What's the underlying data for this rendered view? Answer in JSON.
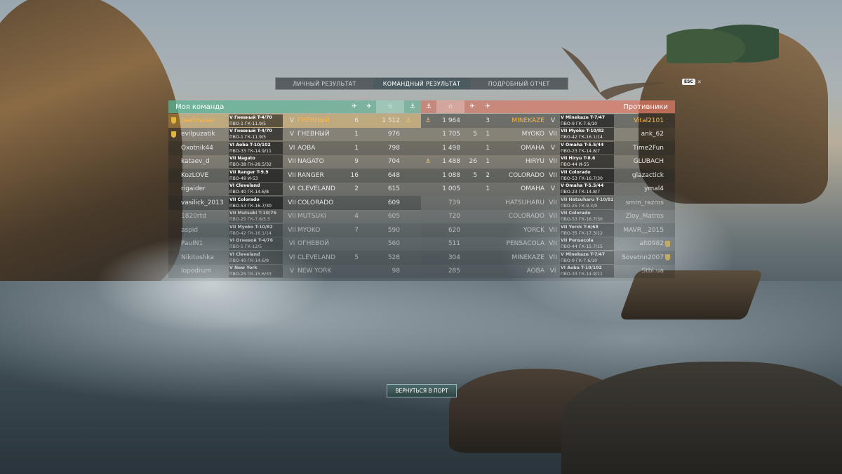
{
  "tabs": [
    "ЛИЧНЫЙ РЕЗУЛЬТАТ",
    "КОМАНДНЫЙ РЕЗУЛЬТАТ",
    "ПОДРОБНЫЙ ОТЧЕТ"
  ],
  "active_tab": 1,
  "esc_key": "ESC",
  "my_team_title": "Моя команда",
  "enemy_team_title": "Противники",
  "icons": {
    "plane": "✈",
    "fighter": "✈",
    "star": "☆",
    "anchor": "⚓",
    "close": "✕"
  },
  "return_button": "ВЕРНУТЬСЯ В ПОРТ",
  "my_team": [
    {
      "player": "beefmaker",
      "me": true,
      "medal": true,
      "card1": "V Гневный     T-4/70",
      "card2": "ПВО-1    ГК-11.9/5",
      "tier": "V",
      "ship": "ГНЕВНЫЙ",
      "frags": "6",
      "xp": "1 512",
      "anchor": true
    },
    {
      "player": "evilpuzatik",
      "medal": true,
      "card1": "V Гневный     T-4/70",
      "card2": "ПВО-1    ГК-11.9/5",
      "tier": "V",
      "ship": "ГНЕВНЫЙ",
      "frags": "1",
      "xp": "976"
    },
    {
      "player": "Oxotnik44",
      "card1": "VI Aoba    T-10/102",
      "card2": "ПВО-33   ГК-14.9/11",
      "tier": "VI",
      "ship": "AOBA",
      "frags": "1",
      "xp": "798"
    },
    {
      "player": "kataev_d",
      "card1": "VII Nagato",
      "card2": "ПВО-38   ГК-28.5/32",
      "tier": "VII",
      "ship": "NAGATO",
      "frags": "9",
      "xp": "704"
    },
    {
      "player": "KozLOVE",
      "card1": "VII Ranger      T-9.9",
      "card2": "ПВО-49        И-53",
      "tier": "VII",
      "ship": "RANGER",
      "frags": "16",
      "xp": "648"
    },
    {
      "player": "rigaider",
      "card1": "VI Cleveland",
      "card2": "ПВО-40   ГК-14.6/8",
      "tier": "VI",
      "ship": "CLEVELAND",
      "frags": "2",
      "xp": "615"
    },
    {
      "player": "vasilick_2013",
      "card1": "VII Colorado",
      "card2": "ПВО-53   ГК-16.7/30",
      "tier": "VII",
      "ship": "COLORADO",
      "frags": "",
      "xp": "609"
    },
    {
      "player": "1820rtd",
      "dead": true,
      "card1": "VII Mutsuki    T-10/76",
      "card2": "ПВО-25  ГК-7.6/5.5",
      "tier": "VII",
      "ship": "MUTSUKI",
      "frags": "4",
      "xp": "605"
    },
    {
      "player": "aspid",
      "dead": true,
      "card1": "VII Myoko     T-10/82",
      "card2": "ПВО-42   ГК-16.1/14",
      "tier": "VII",
      "ship": "MYOKO",
      "frags": "7",
      "xp": "590"
    },
    {
      "player": "PaulN1",
      "dead": true,
      "card1": "VI Огневой     T-4/76",
      "card2": "ПВО-1    ГК-12/5",
      "tier": "VI",
      "ship": "ОГНЕВОЙ",
      "frags": "",
      "xp": "560"
    },
    {
      "player": "Nikitoshka",
      "dead": true,
      "card1": "VI Cleveland",
      "card2": "ПВО-40   ГК-14.6/8",
      "tier": "VI",
      "ship": "CLEVELAND",
      "frags": "5",
      "xp": "528"
    },
    {
      "player": "lopodrum",
      "dead": true,
      "card1": "V New York",
      "card2": "ПВО-25    ГК-15.6/33",
      "tier": "V",
      "ship": "NEW YORK",
      "frags": "",
      "xp": "98"
    }
  ],
  "enemy_team": [
    {
      "player": "Vital2101",
      "anchor": true,
      "xp": "1 964",
      "frags": "",
      "frags2": "3",
      "ship": "MINEKAZE",
      "tier": "V",
      "card1": "V Minekaze    T-7/47",
      "card2": "ПВО-9    ГК-7.6/10"
    },
    {
      "player": "ank_62",
      "xp": "1 705",
      "frags": "5",
      "frags2": "1",
      "ship": "MYOKO",
      "tier": "VII",
      "card1": "VII Myoko     T-10/82",
      "card2": "ПВО-42   ГК-16.1/14"
    },
    {
      "player": "Time2Fun",
      "xp": "1 498",
      "frags": "",
      "frags2": "1",
      "ship": "OMAHA",
      "tier": "V",
      "card1": "V Omaha      T-5.5/44",
      "card2": "ПВО-23    ГК-14.8/7"
    },
    {
      "player": "GLUBACH",
      "anchor": true,
      "xp": "1 488",
      "frags": "26",
      "frags2": "1",
      "ship": "HIRYU",
      "tier": "VII",
      "card1": "VII Hiryu         T-8.6",
      "card2": "ПВО-44          И-55"
    },
    {
      "player": "glazactick",
      "xp": "1 088",
      "frags": "5",
      "frags2": "2",
      "ship": "COLORADO",
      "tier": "VII",
      "card1": "VII Colorado",
      "card2": "ПВО-53   ГК-16.7/30"
    },
    {
      "player": "ymal4",
      "xp": "1 005",
      "frags": "",
      "frags2": "1",
      "ship": "OMAHA",
      "tier": "V",
      "card1": "V Omaha      T-5.5/44",
      "card2": "ПВО-23    ГК-14.8/7"
    },
    {
      "player": "smm_razros",
      "dead": true,
      "xp": "739",
      "frags": "",
      "frags2": "",
      "ship": "HATSUHARU",
      "tier": "VII",
      "card1": "VII Hatsuharu  T-10/82",
      "card2": "ПВО-25   ГК-9.3/9"
    },
    {
      "player": "Zloy_Matros",
      "dead": true,
      "xp": "720",
      "frags": "",
      "frags2": "",
      "ship": "COLORADO",
      "tier": "VII",
      "card1": "VII Colorado",
      "card2": "ПВО-53   ГК-16.7/30"
    },
    {
      "player": "MAVR__2015",
      "dead": true,
      "xp": "620",
      "frags": "",
      "frags2": "",
      "ship": "YORCK",
      "tier": "VII",
      "card1": "VII Yorck       T-6/68",
      "card2": "ПВО-35   ГК-17.3/12"
    },
    {
      "player": "alt0982",
      "dead": true,
      "medal": true,
      "xp": "511",
      "frags": "",
      "frags2": "",
      "ship": "PENSACOLA",
      "tier": "VII",
      "card1": "VII Pensacola",
      "card2": "ПВО-44   ГК-15.7/15"
    },
    {
      "player": "Sovetnn2007",
      "dead": true,
      "medal": true,
      "xp": "304",
      "frags": "",
      "frags2": "",
      "ship": "MINEKAZE",
      "tier": "VII",
      "card1": "V Minekaze    T-7/47",
      "card2": "ПВО-9    ГК-7.6/10"
    },
    {
      "player": "Stbl.ua",
      "dead": true,
      "xp": "285",
      "frags": "",
      "frags2": "",
      "ship": "AOBA",
      "tier": "VI",
      "card1": "VI Aoba      T-10/102",
      "card2": "ПВО-33   ГК-14.9/11"
    }
  ]
}
